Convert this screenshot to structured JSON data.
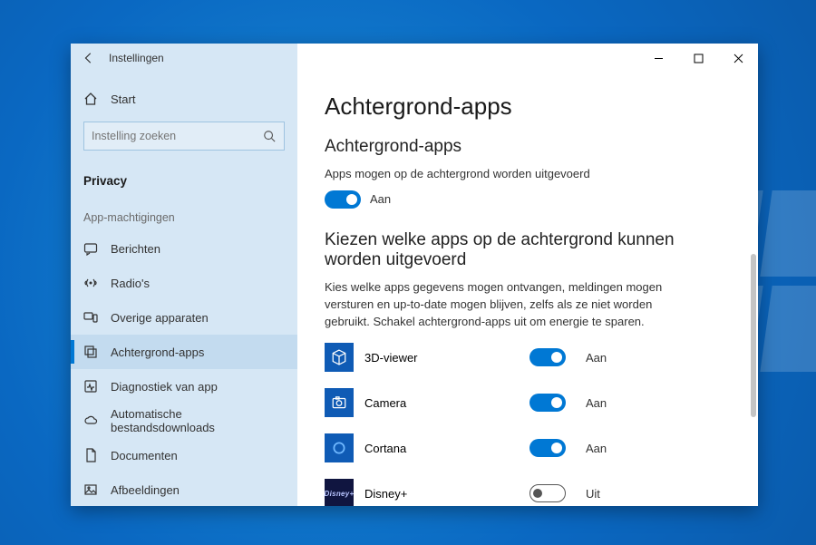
{
  "window": {
    "title": "Instellingen"
  },
  "sidebar": {
    "home": "Start",
    "search_placeholder": "Instelling zoeken",
    "section": "Privacy",
    "group": "App-machtigingen",
    "items": [
      {
        "label": "Berichten"
      },
      {
        "label": "Radio's"
      },
      {
        "label": "Overige apparaten"
      },
      {
        "label": "Achtergrond-apps",
        "selected": true
      },
      {
        "label": "Diagnostiek van app"
      },
      {
        "label": "Automatische bestandsdownloads"
      },
      {
        "label": "Documenten"
      },
      {
        "label": "Afbeeldingen"
      }
    ]
  },
  "page": {
    "title": "Achtergrond-apps",
    "section1": "Achtergrond-apps",
    "global_label": "Apps mogen op de achtergrond worden uitgevoerd",
    "global_state": "Aan",
    "section2": "Kiezen welke apps op de achtergrond kunnen worden uitgevoerd",
    "description": "Kies welke apps gegevens mogen ontvangen, meldingen mogen versturen en up-to-date mogen blijven, zelfs als ze niet worden gebruikt. Schakel achtergrond-apps uit om energie te sparen.",
    "apps": [
      {
        "name": "3D-viewer",
        "state": "Aan",
        "on": true,
        "icon": "cube"
      },
      {
        "name": "Camera",
        "state": "Aan",
        "on": true,
        "icon": "camera"
      },
      {
        "name": "Cortana",
        "state": "Aan",
        "on": true,
        "icon": "ring"
      },
      {
        "name": "Disney+",
        "state": "Uit",
        "on": false,
        "icon": "disney"
      }
    ]
  }
}
